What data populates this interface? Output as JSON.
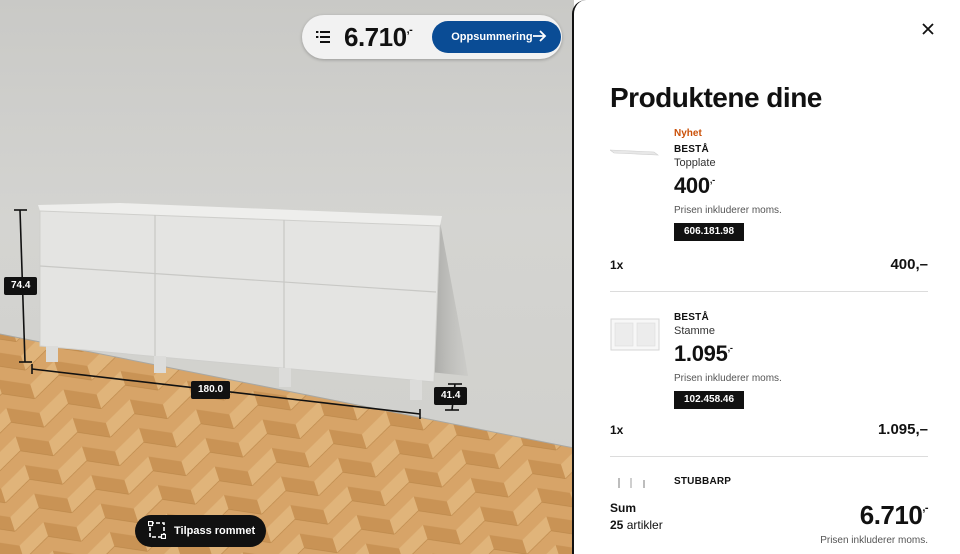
{
  "viewport": {
    "price_pill": {
      "price": "6.710",
      "suffix": ",-"
    },
    "summary_button_label": "Oppsummering",
    "customize_button_label": "Tilpass rommet",
    "dimensions": {
      "height": "74.4",
      "width": "180.0",
      "depth": "41.4"
    }
  },
  "panel": {
    "title": "Produktene dine",
    "products": [
      {
        "badge": "Nyhet",
        "name": "BESTÅ",
        "description": "Topplate",
        "price": "400",
        "price_suffix": ",-",
        "vat_note": "Prisen inkluderer moms.",
        "article_number": "606.181.98",
        "quantity": "1x",
        "line_total": "400,–"
      },
      {
        "badge": "",
        "name": "BESTÅ",
        "description": "Stamme",
        "price": "1.095",
        "price_suffix": ",-",
        "vat_note": "Prisen inkluderer moms.",
        "article_number": "102.458.46",
        "quantity": "1x",
        "line_total": "1.095,–"
      },
      {
        "name": "STUBBARP"
      }
    ],
    "summary": {
      "label": "Sum",
      "count": "25",
      "count_label": "artikler",
      "price": "6.710",
      "price_suffix": ",-",
      "vat_note": "Prisen inkluderer moms."
    }
  },
  "colors": {
    "primary_blue": "#0a4c95",
    "new_badge": "#ca5008"
  },
  "icons": [
    "list-icon",
    "arrow-right-icon",
    "close-icon",
    "room-layout-icon"
  ]
}
